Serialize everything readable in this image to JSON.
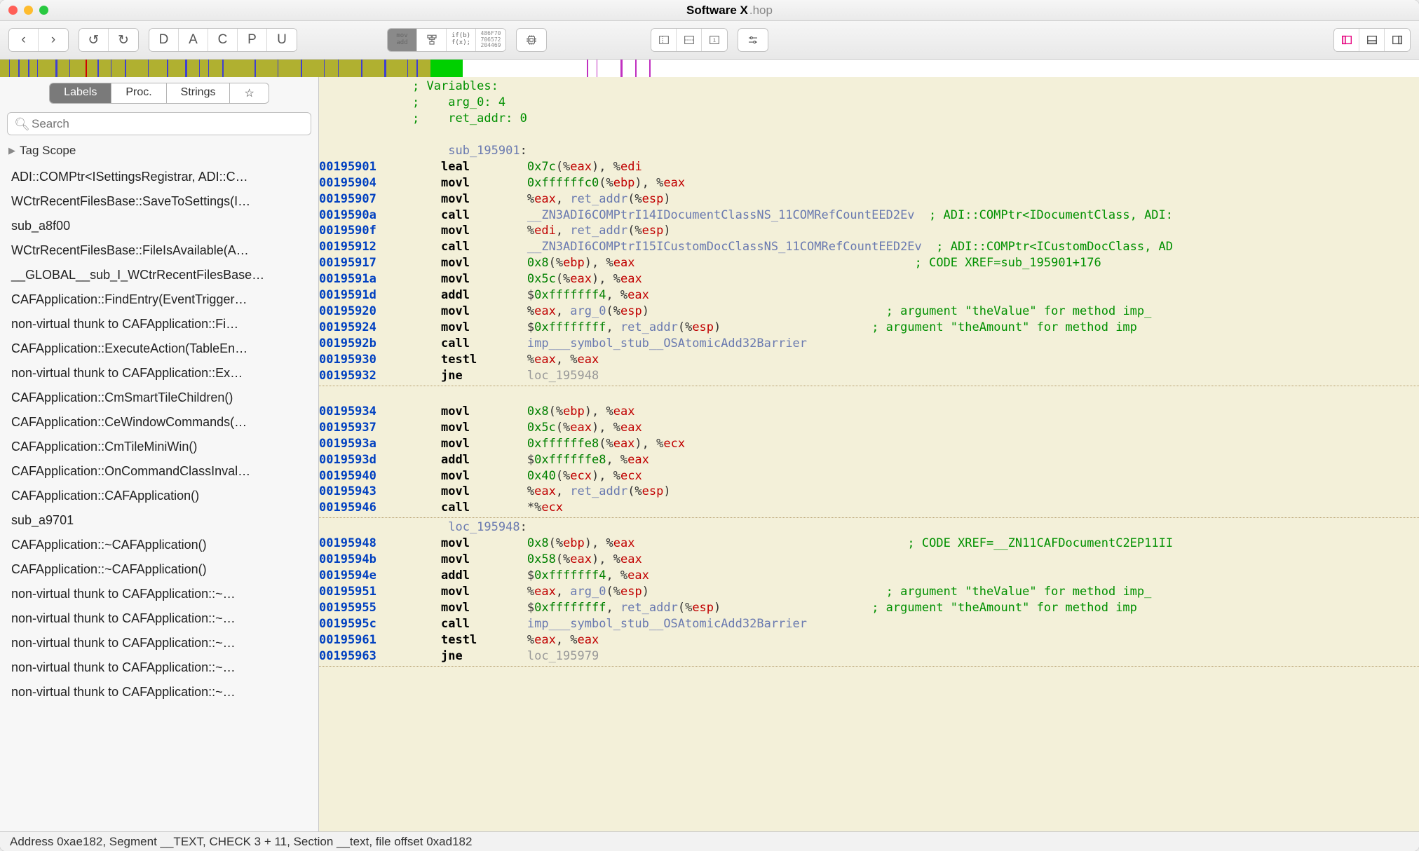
{
  "title_bold": "Software X",
  "title_suffix": ".hop",
  "toolbar": {
    "back": "‹",
    "fwd": "›",
    "undo": "↺",
    "redo": "↻",
    "D": "D",
    "A": "A",
    "C": "C",
    "P": "P",
    "U": "U",
    "asm_top": "mov",
    "asm_bot": "add",
    "hex1": "486F70",
    "hex2": "706572",
    "hex3": "204469"
  },
  "sidebar": {
    "tabs": [
      "Labels",
      "Proc.",
      "Strings",
      "☆"
    ],
    "search_placeholder": "Search",
    "tag_scope": "Tag Scope",
    "items": [
      "ADI::COMPtr<ISettingsRegistrar, ADI::C…",
      "WCtrRecentFilesBase::SaveToSettings(I…",
      "sub_a8f00",
      "WCtrRecentFilesBase::FileIsAvailable(A…",
      "__GLOBAL__sub_I_WCtrRecentFilesBase…",
      "CAFApplication::FindEntry(EventTrigger…",
      "non-virtual thunk to CAFApplication::Fi…",
      "CAFApplication::ExecuteAction(TableEn…",
      "non-virtual thunk to CAFApplication::Ex…",
      "CAFApplication::CmSmartTileChildren()",
      "CAFApplication::CeWindowCommands(…",
      "CAFApplication::CmTileMiniWin()",
      "CAFApplication::OnCommandClassInval…",
      "CAFApplication::CAFApplication()",
      "sub_a9701",
      "CAFApplication::~CAFApplication()",
      "CAFApplication::~CAFApplication()",
      "non-virtual thunk to CAFApplication::~…",
      "non-virtual thunk to CAFApplication::~…",
      "non-virtual thunk to CAFApplication::~…",
      "non-virtual thunk to CAFApplication::~…",
      "non-virtual thunk to CAFApplication::~…"
    ]
  },
  "asm": {
    "hdr": [
      "             ; Variables:",
      "             ;    arg_0: 4",
      "             ;    ret_addr: 0"
    ],
    "sub_label": "sub_195901",
    "loc_label": "loc_195948",
    "lines": [
      {
        "a": "00195901",
        "m": "leal",
        "ops": [
          {
            "t": "imm",
            "v": "0x7c"
          },
          {
            "t": "txt",
            "v": "(%"
          },
          {
            "t": "reg",
            "v": "eax"
          },
          {
            "t": "txt",
            "v": "), %"
          },
          {
            "t": "reg",
            "v": "edi"
          }
        ]
      },
      {
        "a": "00195904",
        "m": "movl",
        "ops": [
          {
            "t": "imm",
            "v": "0xffffffc0"
          },
          {
            "t": "txt",
            "v": "(%"
          },
          {
            "t": "reg",
            "v": "ebp"
          },
          {
            "t": "txt",
            "v": "), %"
          },
          {
            "t": "reg",
            "v": "eax"
          }
        ]
      },
      {
        "a": "00195907",
        "m": "movl",
        "ops": [
          {
            "t": "txt",
            "v": "%"
          },
          {
            "t": "reg",
            "v": "eax"
          },
          {
            "t": "txt",
            "v": ", "
          },
          {
            "t": "sym",
            "v": "ret_addr"
          },
          {
            "t": "txt",
            "v": "(%"
          },
          {
            "t": "reg",
            "v": "esp"
          },
          {
            "t": "txt",
            "v": ")"
          }
        ]
      },
      {
        "a": "0019590a",
        "m": "call",
        "ops": [
          {
            "t": "sym",
            "v": "__ZN3ADI6COMPtrI14IDocumentClassNS_11COMRefCountEED2Ev"
          }
        ],
        "c": "; ADI::COMPtr<IDocumentClass, ADI:"
      },
      {
        "a": "0019590f",
        "m": "movl",
        "ops": [
          {
            "t": "txt",
            "v": "%"
          },
          {
            "t": "reg",
            "v": "edi"
          },
          {
            "t": "txt",
            "v": ", "
          },
          {
            "t": "sym",
            "v": "ret_addr"
          },
          {
            "t": "txt",
            "v": "(%"
          },
          {
            "t": "reg",
            "v": "esp"
          },
          {
            "t": "txt",
            "v": ")"
          }
        ]
      },
      {
        "a": "00195912",
        "m": "call",
        "ops": [
          {
            "t": "sym",
            "v": "__ZN3ADI6COMPtrI15ICustomDocClassNS_11COMRefCountEED2Ev"
          }
        ],
        "c": "; ADI::COMPtr<ICustomDocClass, AD"
      },
      {
        "a": "00195917",
        "m": "movl",
        "ops": [
          {
            "t": "imm",
            "v": "0x8"
          },
          {
            "t": "txt",
            "v": "(%"
          },
          {
            "t": "reg",
            "v": "ebp"
          },
          {
            "t": "txt",
            "v": "), %"
          },
          {
            "t": "reg",
            "v": "eax"
          }
        ],
        "c": "                                     ; CODE XREF=sub_195901+176"
      },
      {
        "a": "0019591a",
        "m": "movl",
        "ops": [
          {
            "t": "imm",
            "v": "0x5c"
          },
          {
            "t": "txt",
            "v": "(%"
          },
          {
            "t": "reg",
            "v": "eax"
          },
          {
            "t": "txt",
            "v": "), %"
          },
          {
            "t": "reg",
            "v": "eax"
          }
        ]
      },
      {
        "a": "0019591d",
        "m": "addl",
        "ops": [
          {
            "t": "txt",
            "v": "$"
          },
          {
            "t": "imm",
            "v": "0xfffffff4"
          },
          {
            "t": "txt",
            "v": ", %"
          },
          {
            "t": "reg",
            "v": "eax"
          }
        ]
      },
      {
        "a": "00195920",
        "m": "movl",
        "ops": [
          {
            "t": "txt",
            "v": "%"
          },
          {
            "t": "reg",
            "v": "eax"
          },
          {
            "t": "txt",
            "v": ", "
          },
          {
            "t": "sym",
            "v": "arg_0"
          },
          {
            "t": "txt",
            "v": "(%"
          },
          {
            "t": "reg",
            "v": "esp"
          },
          {
            "t": "txt",
            "v": ")"
          }
        ],
        "c": "                               ; argument \"theValue\" for method imp_"
      },
      {
        "a": "00195924",
        "m": "movl",
        "ops": [
          {
            "t": "txt",
            "v": "$"
          },
          {
            "t": "imm",
            "v": "0xffffffff"
          },
          {
            "t": "txt",
            "v": ", "
          },
          {
            "t": "sym",
            "v": "ret_addr"
          },
          {
            "t": "txt",
            "v": "(%"
          },
          {
            "t": "reg",
            "v": "esp"
          },
          {
            "t": "txt",
            "v": ")"
          }
        ],
        "c": "                   ; argument \"theAmount\" for method imp"
      },
      {
        "a": "0019592b",
        "m": "call",
        "ops": [
          {
            "t": "sym",
            "v": "imp___symbol_stub__OSAtomicAdd32Barrier"
          }
        ]
      },
      {
        "a": "00195930",
        "m": "testl",
        "ops": [
          {
            "t": "txt",
            "v": "%"
          },
          {
            "t": "reg",
            "v": "eax"
          },
          {
            "t": "txt",
            "v": ", %"
          },
          {
            "t": "reg",
            "v": "eax"
          }
        ]
      },
      {
        "a": "00195932",
        "m": "jne",
        "ops": [
          {
            "t": "gray",
            "v": "loc_195948"
          }
        ]
      }
    ],
    "lines2": [
      {
        "a": "00195934",
        "m": "movl",
        "ops": [
          {
            "t": "imm",
            "v": "0x8"
          },
          {
            "t": "txt",
            "v": "(%"
          },
          {
            "t": "reg",
            "v": "ebp"
          },
          {
            "t": "txt",
            "v": "), %"
          },
          {
            "t": "reg",
            "v": "eax"
          }
        ]
      },
      {
        "a": "00195937",
        "m": "movl",
        "ops": [
          {
            "t": "imm",
            "v": "0x5c"
          },
          {
            "t": "txt",
            "v": "(%"
          },
          {
            "t": "reg",
            "v": "eax"
          },
          {
            "t": "txt",
            "v": "), %"
          },
          {
            "t": "reg",
            "v": "eax"
          }
        ]
      },
      {
        "a": "0019593a",
        "m": "movl",
        "ops": [
          {
            "t": "imm",
            "v": "0xffffffe8"
          },
          {
            "t": "txt",
            "v": "(%"
          },
          {
            "t": "reg",
            "v": "eax"
          },
          {
            "t": "txt",
            "v": "), %"
          },
          {
            "t": "reg",
            "v": "ecx"
          }
        ]
      },
      {
        "a": "0019593d",
        "m": "addl",
        "ops": [
          {
            "t": "txt",
            "v": "$"
          },
          {
            "t": "imm",
            "v": "0xffffffe8"
          },
          {
            "t": "txt",
            "v": ", %"
          },
          {
            "t": "reg",
            "v": "eax"
          }
        ]
      },
      {
        "a": "00195940",
        "m": "movl",
        "ops": [
          {
            "t": "imm",
            "v": "0x40"
          },
          {
            "t": "txt",
            "v": "(%"
          },
          {
            "t": "reg",
            "v": "ecx"
          },
          {
            "t": "txt",
            "v": "), %"
          },
          {
            "t": "reg",
            "v": "ecx"
          }
        ]
      },
      {
        "a": "00195943",
        "m": "movl",
        "ops": [
          {
            "t": "txt",
            "v": "%"
          },
          {
            "t": "reg",
            "v": "eax"
          },
          {
            "t": "txt",
            "v": ", "
          },
          {
            "t": "sym",
            "v": "ret_addr"
          },
          {
            "t": "txt",
            "v": "(%"
          },
          {
            "t": "reg",
            "v": "esp"
          },
          {
            "t": "txt",
            "v": ")"
          }
        ]
      },
      {
        "a": "00195946",
        "m": "call",
        "ops": [
          {
            "t": "txt",
            "v": "*%"
          },
          {
            "t": "reg",
            "v": "ecx"
          }
        ]
      }
    ],
    "lines3": [
      {
        "a": "00195948",
        "m": "movl",
        "ops": [
          {
            "t": "imm",
            "v": "0x8"
          },
          {
            "t": "txt",
            "v": "(%"
          },
          {
            "t": "reg",
            "v": "ebp"
          },
          {
            "t": "txt",
            "v": "), %"
          },
          {
            "t": "reg",
            "v": "eax"
          }
        ],
        "c": "                                    ; CODE XREF=__ZN11CAFDocumentC2EP11II"
      },
      {
        "a": "0019594b",
        "m": "movl",
        "ops": [
          {
            "t": "imm",
            "v": "0x58"
          },
          {
            "t": "txt",
            "v": "(%"
          },
          {
            "t": "reg",
            "v": "eax"
          },
          {
            "t": "txt",
            "v": "), %"
          },
          {
            "t": "reg",
            "v": "eax"
          }
        ]
      },
      {
        "a": "0019594e",
        "m": "addl",
        "ops": [
          {
            "t": "txt",
            "v": "$"
          },
          {
            "t": "imm",
            "v": "0xfffffff4"
          },
          {
            "t": "txt",
            "v": ", %"
          },
          {
            "t": "reg",
            "v": "eax"
          }
        ]
      },
      {
        "a": "00195951",
        "m": "movl",
        "ops": [
          {
            "t": "txt",
            "v": "%"
          },
          {
            "t": "reg",
            "v": "eax"
          },
          {
            "t": "txt",
            "v": ", "
          },
          {
            "t": "sym",
            "v": "arg_0"
          },
          {
            "t": "txt",
            "v": "(%"
          },
          {
            "t": "reg",
            "v": "esp"
          },
          {
            "t": "txt",
            "v": ")"
          }
        ],
        "c": "                               ; argument \"theValue\" for method imp_"
      },
      {
        "a": "00195955",
        "m": "movl",
        "ops": [
          {
            "t": "txt",
            "v": "$"
          },
          {
            "t": "imm",
            "v": "0xffffffff"
          },
          {
            "t": "txt",
            "v": ", "
          },
          {
            "t": "sym",
            "v": "ret_addr"
          },
          {
            "t": "txt",
            "v": "(%"
          },
          {
            "t": "reg",
            "v": "esp"
          },
          {
            "t": "txt",
            "v": ")"
          }
        ],
        "c": "                   ; argument \"theAmount\" for method imp"
      },
      {
        "a": "0019595c",
        "m": "call",
        "ops": [
          {
            "t": "sym",
            "v": "imp___symbol_stub__OSAtomicAdd32Barrier"
          }
        ]
      },
      {
        "a": "00195961",
        "m": "testl",
        "ops": [
          {
            "t": "txt",
            "v": "%"
          },
          {
            "t": "reg",
            "v": "eax"
          },
          {
            "t": "txt",
            "v": ", %"
          },
          {
            "t": "reg",
            "v": "eax"
          }
        ]
      },
      {
        "a": "00195963",
        "m": "jne",
        "ops": [
          {
            "t": "gray",
            "v": "loc_195979"
          }
        ]
      }
    ]
  },
  "status": "Address 0xae182, Segment __TEXT, CHECK 3 + 11, Section __text, file offset 0xad182"
}
